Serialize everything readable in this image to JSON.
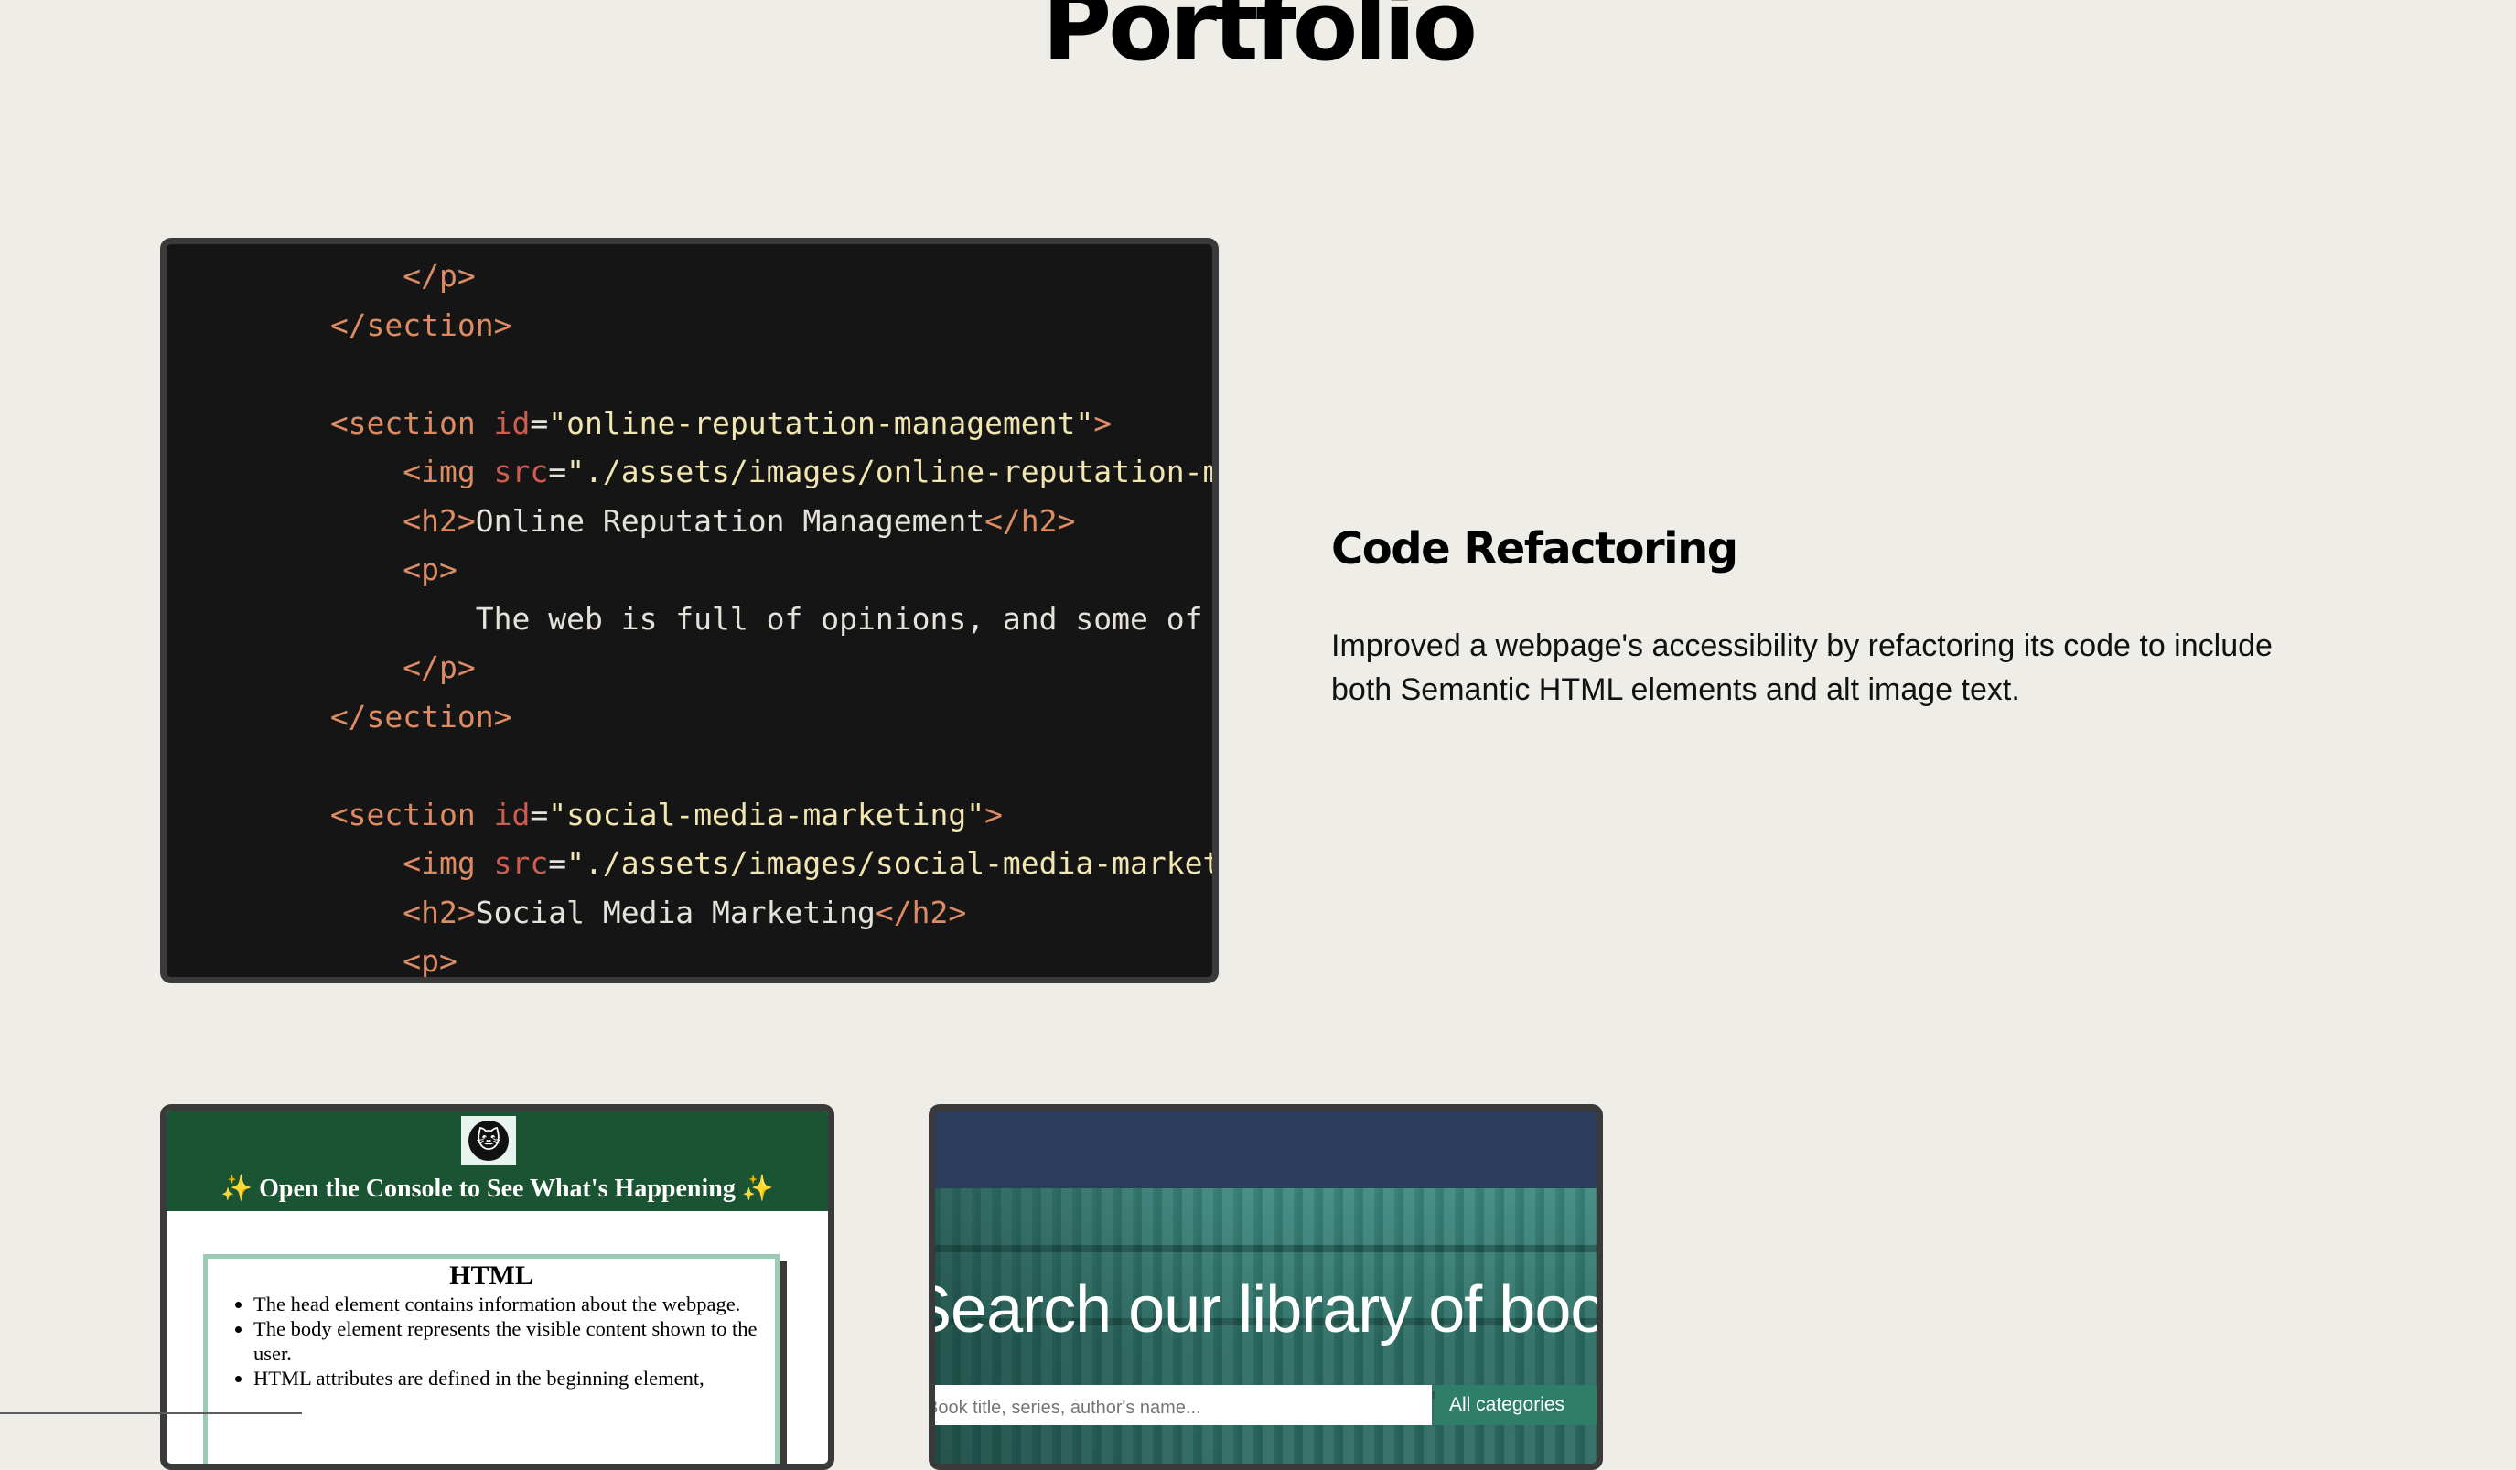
{
  "page": {
    "title": "Portfolio"
  },
  "projects": [
    {
      "title": "Code Refactoring",
      "description": "Improved a webpage's accessibility by refactoring its code to include both Semantic HTML elements and alt image text.",
      "code_lines": [
        {
          "indent": "        ",
          "parts": [
            [
              "tag",
              "</p>"
            ]
          ]
        },
        {
          "indent": "    ",
          "parts": [
            [
              "tag",
              "</section>"
            ]
          ]
        },
        {
          "indent": "",
          "parts": []
        },
        {
          "indent": "    ",
          "parts": [
            [
              "tag",
              "<section "
            ],
            [
              "attr",
              "id"
            ],
            [
              "eq",
              "="
            ],
            [
              "str",
              "\"online-reputation-management\""
            ],
            [
              "tag",
              ">"
            ]
          ]
        },
        {
          "indent": "        ",
          "parts": [
            [
              "tag",
              "<img "
            ],
            [
              "attr",
              "src"
            ],
            [
              "eq",
              "="
            ],
            [
              "str",
              "\"./assets/images/online-reputation-ma"
            ]
          ]
        },
        {
          "indent": "        ",
          "parts": [
            [
              "tag",
              "<h2>"
            ],
            [
              "plain",
              "Online Reputation Management"
            ],
            [
              "tag",
              "</h2>"
            ]
          ]
        },
        {
          "indent": "        ",
          "parts": [
            [
              "tag",
              "<p>"
            ]
          ]
        },
        {
          "indent": "            ",
          "parts": [
            [
              "plain",
              "The web is full of opinions, and some of t"
            ]
          ]
        },
        {
          "indent": "        ",
          "parts": [
            [
              "tag",
              "</p>"
            ]
          ]
        },
        {
          "indent": "    ",
          "parts": [
            [
              "tag",
              "</section>"
            ]
          ]
        },
        {
          "indent": "",
          "parts": []
        },
        {
          "indent": "    ",
          "parts": [
            [
              "tag",
              "<section "
            ],
            [
              "attr",
              "id"
            ],
            [
              "eq",
              "="
            ],
            [
              "str",
              "\"social-media-marketing\""
            ],
            [
              "tag",
              ">"
            ]
          ]
        },
        {
          "indent": "        ",
          "parts": [
            [
              "tag",
              "<img "
            ],
            [
              "attr",
              "src"
            ],
            [
              "eq",
              "="
            ],
            [
              "str",
              "\"./assets/images/social-media-marketi"
            ]
          ]
        },
        {
          "indent": "        ",
          "parts": [
            [
              "tag",
              "<h2>"
            ],
            [
              "plain",
              "Social Media Marketing"
            ],
            [
              "tag",
              "</h2>"
            ]
          ]
        },
        {
          "indent": "        ",
          "parts": [
            [
              "tag",
              "<p>"
            ]
          ]
        }
      ]
    }
  ],
  "console_card": {
    "heading_sparkle": "✨",
    "heading": "Open the Console to See What's Happening",
    "cat_icon": "cat-face-icon",
    "html_box": {
      "title": "HTML",
      "items": [
        "The head element contains information about the webpage.",
        "The body element represents the visible content shown to the user.",
        "HTML attributes are defined in the beginning element,"
      ]
    }
  },
  "library_card": {
    "hero_text": "Search our library of books",
    "search_placeholder": "Book title, series, author's name...",
    "category_button": "All categories"
  },
  "colors": {
    "background": "#eeede7",
    "code_bg": "#151515",
    "console_header": "#1a5432",
    "library_nav": "#2b3c5d"
  }
}
